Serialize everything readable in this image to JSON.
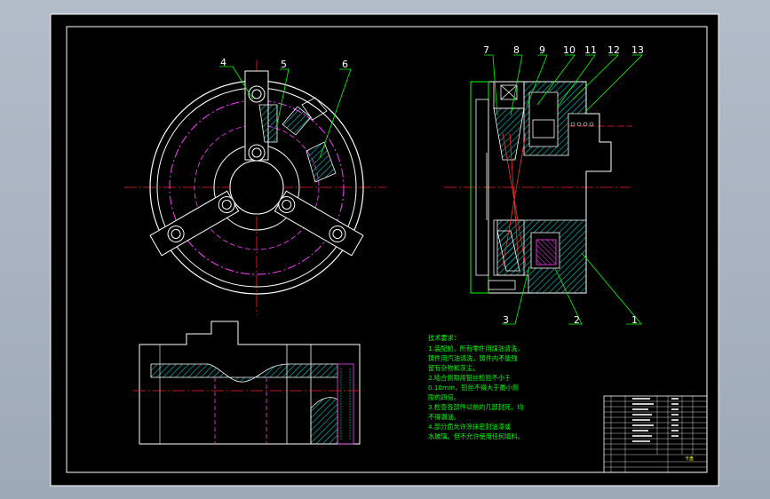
{
  "part_numbers": [
    "4",
    "5",
    "6",
    "7",
    "8",
    "9",
    "10",
    "11",
    "12",
    "13",
    "3",
    "2",
    "1"
  ],
  "notes": {
    "title": "技术要求：",
    "lines": [
      "1.装配前，所有零件用煤油清洗，",
      "铸件用汽油清洗，铸件内不能残",
      "留有杂物和灰尘。",
      "2.啮合侧隙用铅丝检验不小于",
      "0.10mm，铅丝不得大于最小侧",
      "隙的四倍。",
      "3.检查各部件以前的几部封死，均",
      "不得漏油。",
      "4.部分面允许涂抹密封油漆或",
      "水玻璃。但不允许使用任何填料。"
    ]
  },
  "title_block": {
    "name": "卡盘"
  }
}
